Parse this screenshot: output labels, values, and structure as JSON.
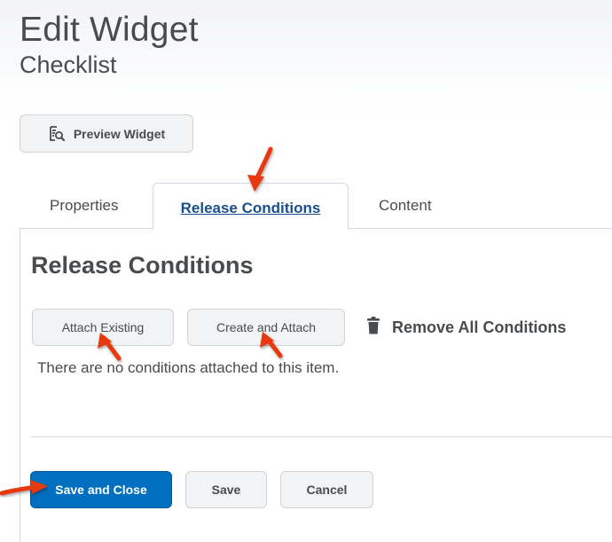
{
  "header": {
    "title": "Edit Widget",
    "subtitle": "Checklist",
    "preview_button_label": "Preview Widget"
  },
  "tabs": [
    {
      "label": "Properties",
      "active": false
    },
    {
      "label": "Release Conditions",
      "active": true
    },
    {
      "label": "Content",
      "active": false
    }
  ],
  "release_conditions": {
    "section_title": "Release Conditions",
    "attach_existing_label": "Attach Existing",
    "create_and_attach_label": "Create and Attach",
    "remove_all_label": "Remove All Conditions",
    "empty_message": "There are no conditions attached to this item."
  },
  "footer": {
    "save_and_close_label": "Save and Close",
    "save_label": "Save",
    "cancel_label": "Cancel"
  },
  "colors": {
    "primary_button": "#006fbf",
    "active_tab_text": "#1a4e8c",
    "annotation_arrow": "#e8380d",
    "text": "#494c4e"
  },
  "icons": {
    "preview": "preview-magnifier-icon",
    "remove": "trash-icon",
    "annotation": "red-arrow-icon"
  }
}
